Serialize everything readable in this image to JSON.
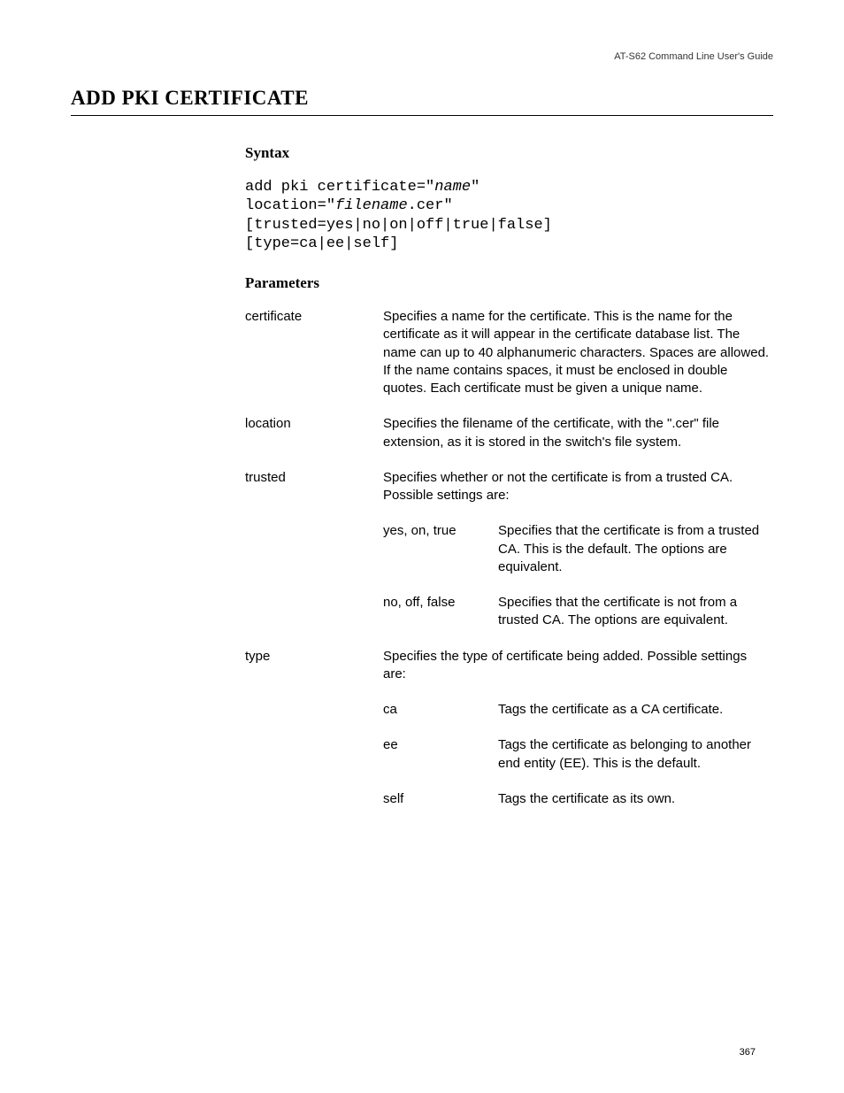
{
  "header": "AT-S62 Command Line User's Guide",
  "title": "ADD PKI CERTIFICATE",
  "syntax_heading": "Syntax",
  "syntax": {
    "l1a": "add pki certificate=\"",
    "l1b": "name",
    "l1c": "\"",
    "l2a": "location=\"",
    "l2b": "filename",
    "l2c": ".cer\"",
    "l3": "[trusted=yes|no|on|off|true|false]",
    "l4": "[type=ca|ee|self]"
  },
  "parameters_heading": "Parameters",
  "params": {
    "certificate": {
      "name": "certificate",
      "desc": "Specifies a name for the certificate. This is the name for the certificate as it will appear in the certificate database list. The name can up to 40 alphanumeric characters. Spaces are allowed. If the name contains spaces, it must be enclosed in double quotes. Each certificate must be given a unique name."
    },
    "location": {
      "name": "location",
      "desc": "Specifies the filename of the certificate, with the \".cer\" file extension, as it is stored in the switch's file system."
    },
    "trusted": {
      "name": "trusted",
      "desc": "Specifies whether or not the certificate is from a trusted CA. Possible settings are:",
      "sub": {
        "yes": {
          "name": "yes, on, true",
          "desc": "Specifies that the certificate is from a trusted CA. This is the default. The options are equivalent."
        },
        "no": {
          "name": "no, off, false",
          "desc": "Specifies that the certificate is not from a trusted CA. The options are equivalent."
        }
      }
    },
    "type": {
      "name": "type",
      "desc": "Specifies the type of certificate being added. Possible settings are:",
      "sub": {
        "ca": {
          "name": "ca",
          "desc": "Tags the certificate as a CA certificate."
        },
        "ee": {
          "name": "ee",
          "desc": "Tags the certificate as belonging to another end entity (EE). This is the default."
        },
        "self": {
          "name": "self",
          "desc": "Tags the certificate as its own."
        }
      }
    }
  },
  "page_number": "367"
}
